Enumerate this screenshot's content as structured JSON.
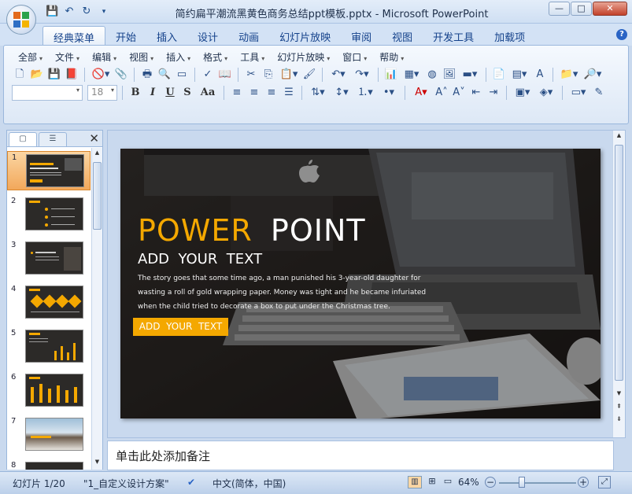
{
  "window": {
    "title": "简约扁平潮流黑黄色商务总结ppt模板.pptx - Microsoft PowerPoint",
    "controls": [
      "—",
      "□",
      "✕"
    ]
  },
  "ribbon_tabs": [
    {
      "label": "经典菜单",
      "active": true
    },
    {
      "label": "开始"
    },
    {
      "label": "插入"
    },
    {
      "label": "设计"
    },
    {
      "label": "动画"
    },
    {
      "label": "幻灯片放映"
    },
    {
      "label": "审阅"
    },
    {
      "label": "视图"
    },
    {
      "label": "开发工具"
    },
    {
      "label": "加载项"
    }
  ],
  "classic_menu": [
    "全部",
    "文件",
    "编辑",
    "视图",
    "插入",
    "格式",
    "工具",
    "幻灯片放映",
    "窗口",
    "帮助"
  ],
  "font_size": "18",
  "format_buttons": [
    "B",
    "I",
    "U",
    "S",
    "Aa"
  ],
  "slide_thumbnails": [
    {
      "num": "1",
      "selected": true
    },
    {
      "num": "2"
    },
    {
      "num": "3"
    },
    {
      "num": "4"
    },
    {
      "num": "5"
    },
    {
      "num": "6"
    },
    {
      "num": "7"
    },
    {
      "num": "8"
    }
  ],
  "slide": {
    "title_accent": "POWER",
    "title_main": "POINT",
    "subtitle": "ADD  YOUR  TEXT",
    "body_lines": [
      "The story goes that some time ago, a man punished his 3-year-old daughter for",
      "wasting a roll of gold wrapping paper. Money was tight and he became infuriated",
      "when the child tried to decorate a box to put under the Christmas tree."
    ],
    "button_label": "ADD  YOUR  TEXT",
    "accent_color": "#f4a800"
  },
  "notes_placeholder": "单击此处添加备注",
  "status": {
    "slide_info": "幻灯片 1/20",
    "theme": "\"1_自定义设计方案\"",
    "language": "中文(简体，中国)",
    "zoom": "64%"
  }
}
